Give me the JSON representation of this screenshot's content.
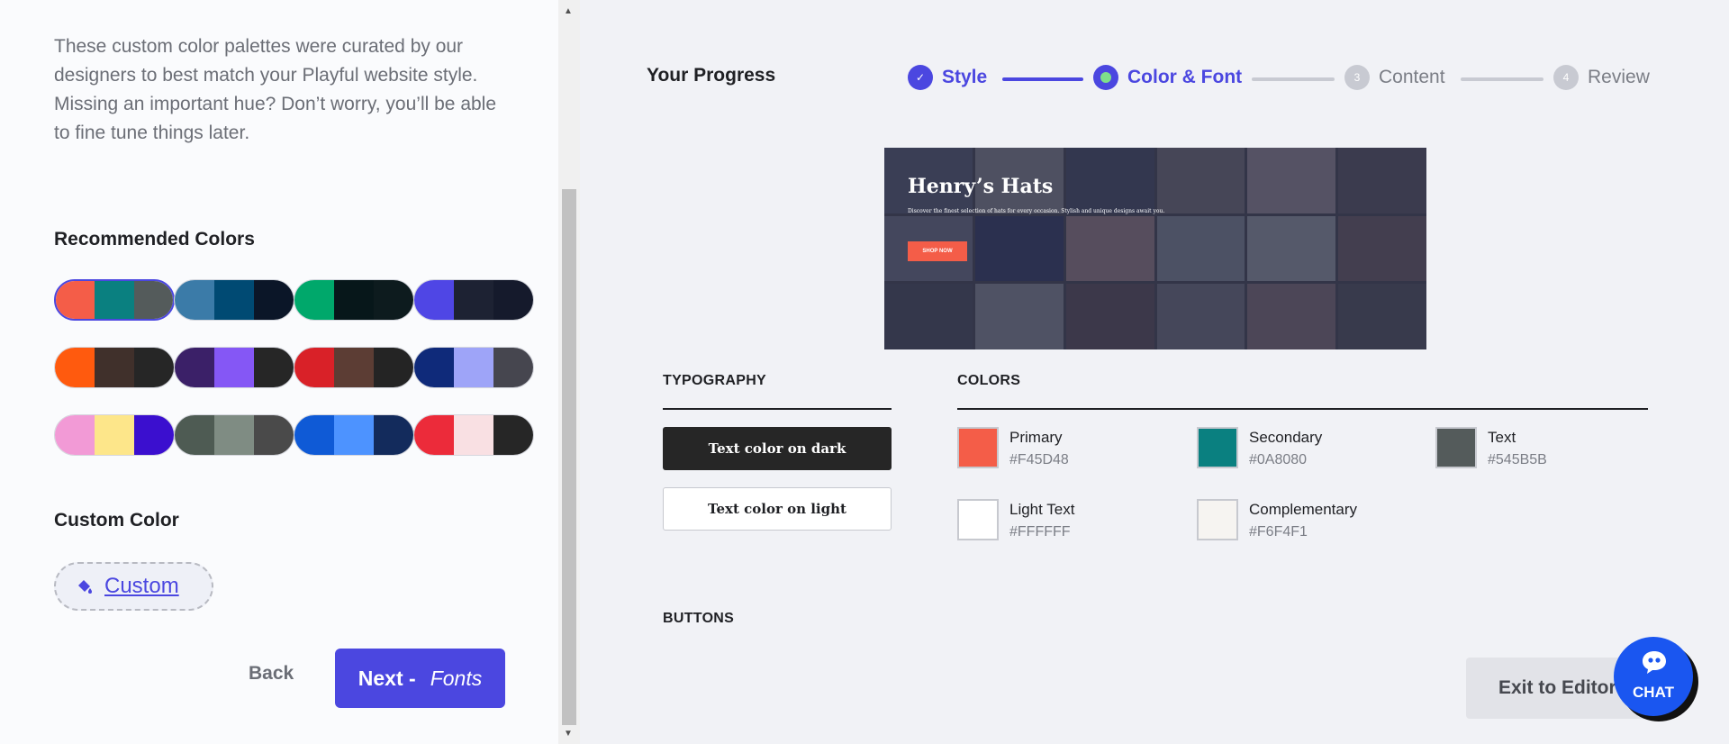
{
  "left": {
    "intro": "These custom color palettes were curated by our designers to best match your Playful website style. Missing an important hue? Don’t worry, you’ll be able to fine tune things later.",
    "recommended_title": "Recommended Colors",
    "palettes": [
      [
        "#f45d48",
        "#0a8080",
        "#545b5b"
      ],
      [
        "#3b7ba8",
        "#004a73",
        "#0b1628"
      ],
      [
        "#00a86b",
        "#07171a",
        "#0d1b1e"
      ],
      [
        "#4f46e5",
        "#1d2233",
        "#151a2c"
      ],
      [
        "#ff5a0e",
        "#40302b",
        "#262626"
      ],
      [
        "#3b2068",
        "#8557f5",
        "#262626"
      ],
      [
        "#d92128",
        "#5c3d34",
        "#242424"
      ],
      [
        "#0f2a7a",
        "#9ea4f8",
        "#46464f"
      ],
      [
        "#f29ad6",
        "#fde68a",
        "#3b0fcf"
      ],
      [
        "#4e5b53",
        "#7f8c83",
        "#4a4a4a"
      ],
      [
        "#0f5ad6",
        "#4d93ff",
        "#132b5c"
      ],
      [
        "#ec2b3a",
        "#f9e0e3",
        "#262626"
      ]
    ],
    "custom_title": "Custom Color",
    "custom_label": "Custom",
    "back_label": "Back",
    "next_label": "Next -",
    "next_sub": "Fonts"
  },
  "progress": {
    "title": "Your Progress",
    "steps": [
      {
        "label": "Style",
        "marker": "✓",
        "state": "done"
      },
      {
        "label": "Color & Font",
        "marker": "",
        "state": "current"
      },
      {
        "label": "Content",
        "marker": "3",
        "state": "todo"
      },
      {
        "label": "Review",
        "marker": "4",
        "state": "todo"
      }
    ]
  },
  "preview": {
    "title": "Henry’s Hats",
    "subtitle": "Discover the finest selection of hats for every occasion. Stylish and unique designs await you.",
    "button": "SHOP NOW"
  },
  "typography": {
    "heading": "TYPOGRAPHY",
    "on_dark": "Text color on dark",
    "on_light": "Text color on light"
  },
  "colors": {
    "heading": "COLORS",
    "items": [
      {
        "name": "Primary",
        "hex": "#F45D48",
        "color": "#f45d48"
      },
      {
        "name": "Secondary",
        "hex": "#0A8080",
        "color": "#0a8080"
      },
      {
        "name": "Text",
        "hex": "#545B5B",
        "color": "#545b5b"
      },
      {
        "name": "Light Text",
        "hex": "#FFFFFF",
        "color": "#ffffff"
      },
      {
        "name": "Complementary",
        "hex": "#F6F4F1",
        "color": "#f6f4f1"
      }
    ]
  },
  "buttons_heading": "BUTTONS",
  "exit_label": "Exit to Editor",
  "chat_label": "CHAT",
  "accent": "#4b47e0"
}
